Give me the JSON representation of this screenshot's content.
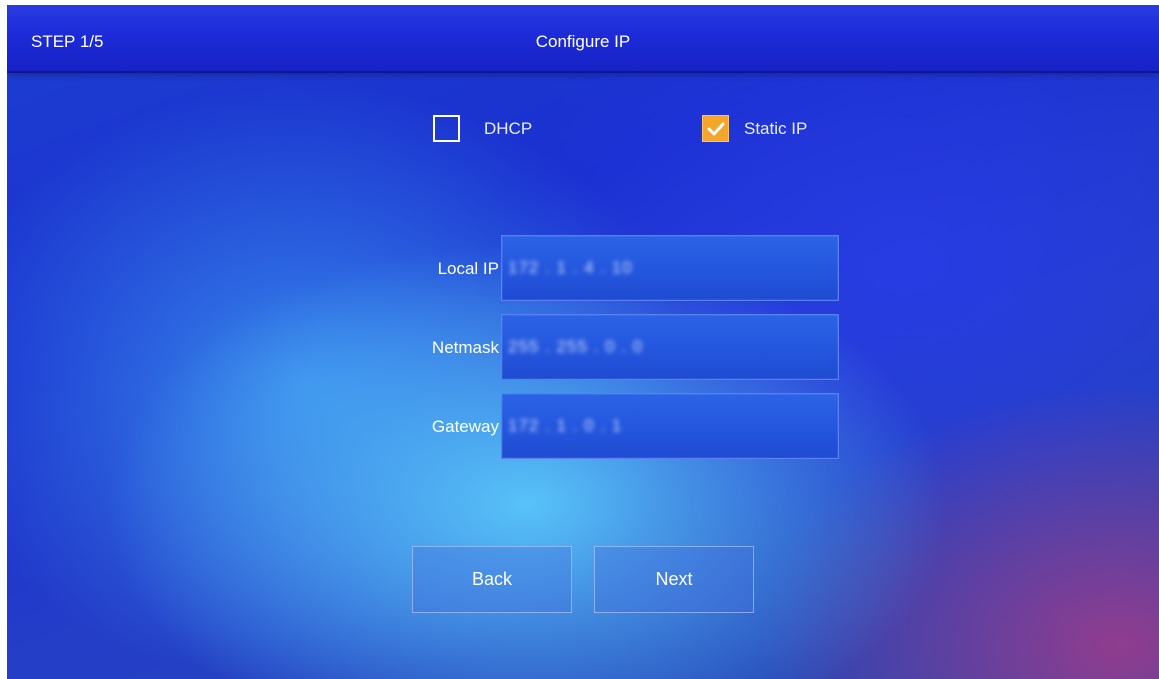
{
  "header": {
    "step": "STEP 1/5",
    "title": "Configure IP"
  },
  "ip_mode": {
    "options": [
      {
        "label": "DHCP",
        "checked": false
      },
      {
        "label": "Static IP",
        "checked": true
      }
    ]
  },
  "fields": {
    "local_ip": {
      "label": "Local IP",
      "value": "172 . 1 . 4 . 10"
    },
    "netmask": {
      "label": "Netmask",
      "value": "255 . 255 . 0 . 0"
    },
    "gateway": {
      "label": "Gateway",
      "value": "172 . 1 . 0 . 1"
    }
  },
  "buttons": {
    "back": "Back",
    "next": "Next"
  },
  "colors": {
    "checkbox_checked": "#f4a62a",
    "background_blue": "#1a2fcf"
  },
  "icons": {
    "checkmark": "checkmark-icon"
  }
}
